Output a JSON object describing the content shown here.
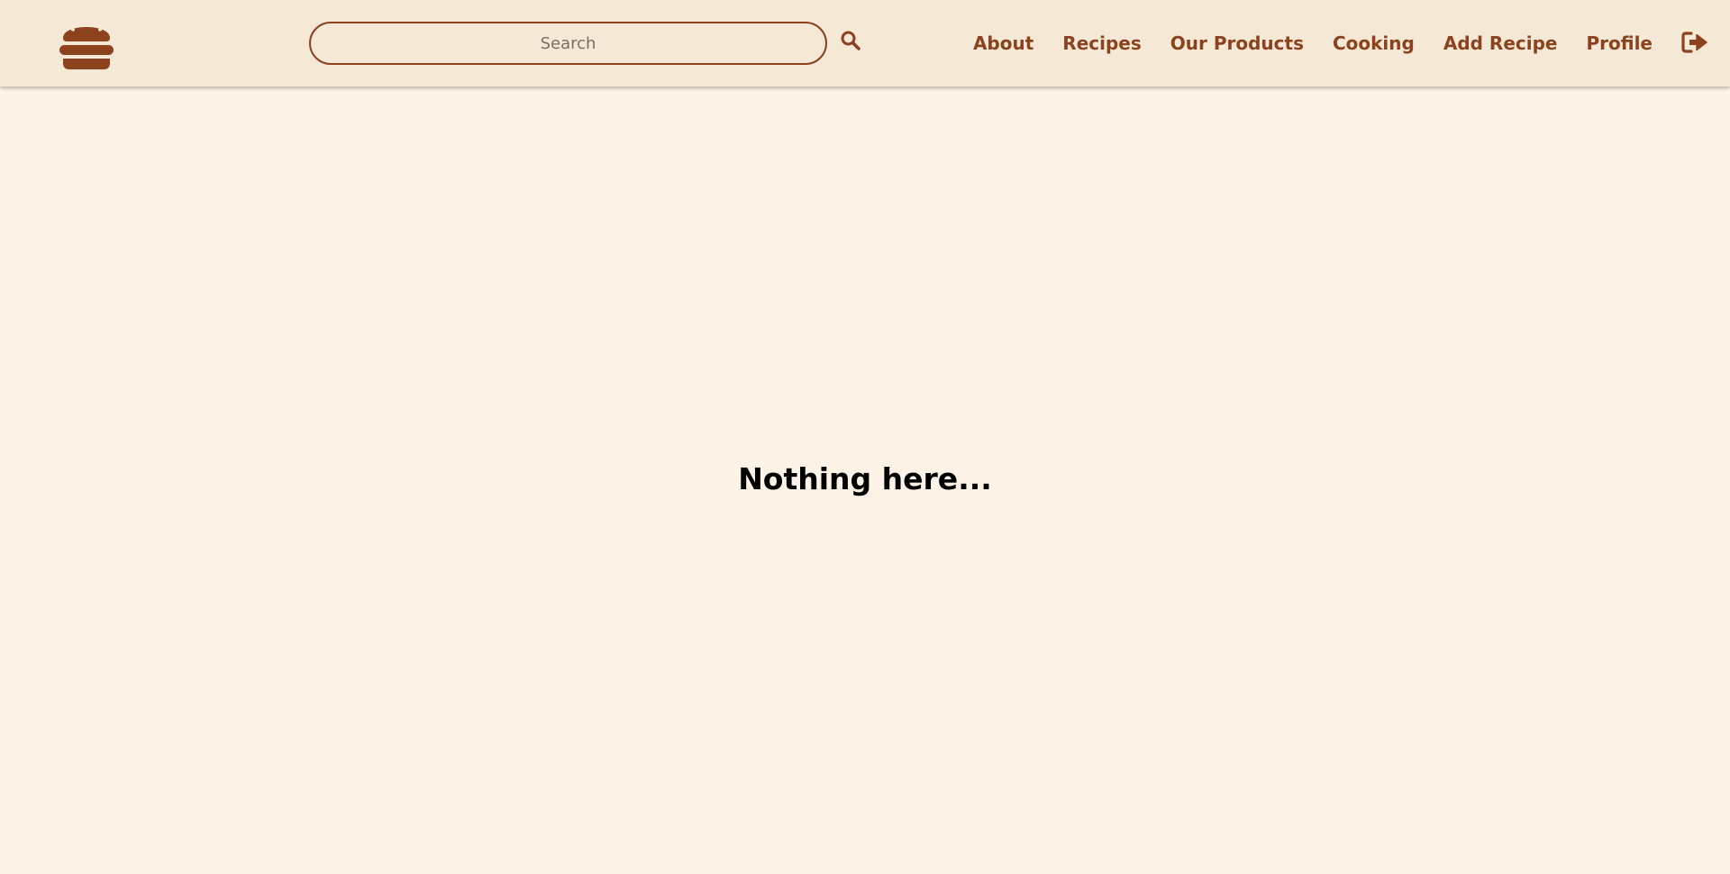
{
  "colors": {
    "brand": "#8b421d",
    "navbar_bg": "#f6e8d7",
    "page_bg": "#fdf4e7",
    "text": "#000000"
  },
  "header": {
    "logo_icon": "hamburger-burger-icon",
    "search": {
      "placeholder": "Search",
      "value": "",
      "button_icon": "search-icon"
    },
    "nav": {
      "about": "About",
      "recipes": "Recipes",
      "our_products": "Our Products",
      "cooking": "Cooking",
      "add_recipe": "Add Recipe",
      "profile": "Profile"
    },
    "logout_icon": "logout-icon"
  },
  "main": {
    "empty_message": "Nothing here..."
  }
}
